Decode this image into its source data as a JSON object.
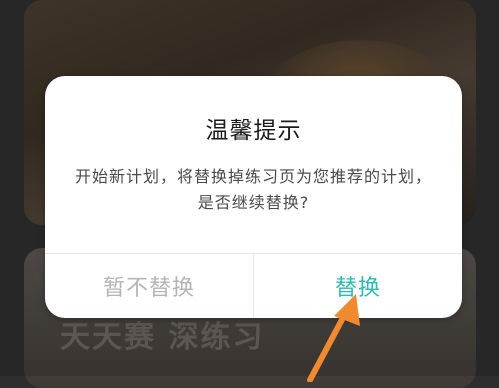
{
  "background": {
    "bottom_card_text": "天天赛 深练习"
  },
  "dialog": {
    "title": "温馨提示",
    "message": "开始新计划，将替换掉练习页为您推荐的计划，是否继续替换?",
    "cancel_label": "暂不替换",
    "confirm_label": "替换"
  },
  "colors": {
    "accent": "#2fb9b4",
    "cancel_text": "#b5b5b5",
    "arrow": "#f08a30"
  }
}
